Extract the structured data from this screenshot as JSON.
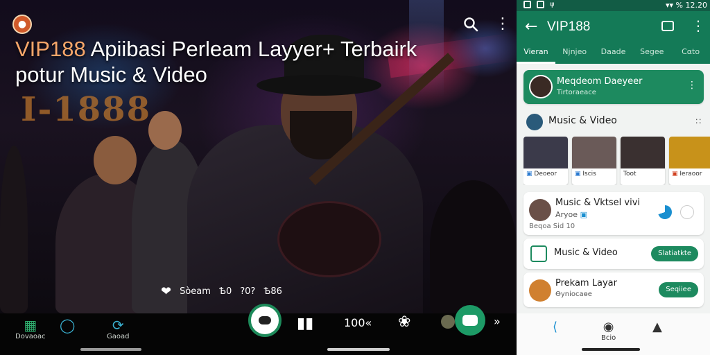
{
  "video": {
    "title_brand": "VIP188",
    "title_rest": " Apiibasi Perleam Layyer+ Terbairk potur Music & Video",
    "background_sign": "I-1888",
    "stats": [
      "Sòeam",
      "Ѣ0",
      "?0?",
      "Ѣ86"
    ],
    "bottom_items": [
      {
        "icon": "download-icon",
        "label": "Dovaoac"
      },
      {
        "icon": "chat-icon",
        "label": ""
      },
      {
        "icon": "refresh-icon",
        "label": "Gaoad"
      },
      {
        "icon": "equalizer-icon",
        "label": ""
      },
      {
        "icon": "speed-text",
        "label": "100«"
      },
      {
        "icon": "settings-icon",
        "label": ""
      },
      {
        "icon": "avatar-icon",
        "label": ""
      },
      {
        "icon": "collapse-icon",
        "label": "»"
      }
    ]
  },
  "phone": {
    "status": {
      "time": "12.20",
      "signal": "▾▾ %"
    },
    "app_title": "VIP188",
    "tabs": [
      "Vieran",
      "Njnjeo",
      "Daade",
      "Segee",
      "Cαto"
    ],
    "active_tab": 0,
    "hero": {
      "title": "Meqdeom Daeyeer",
      "subtitle": "Tirtoraeace"
    },
    "section_title": "Music & Video",
    "thumbs": [
      {
        "label": "Deoeor",
        "color": "#3b3a4a"
      },
      {
        "label": "Iscis",
        "color": "#6a5a58"
      },
      {
        "label": "Toot",
        "color": "#3a3030"
      },
      {
        "label": "Ieraoor",
        "color": "#c8921a"
      },
      {
        "label": "",
        "color": "#4a6a80"
      }
    ],
    "rows": [
      {
        "title": "Music & Vktsel vivi",
        "subtitle": "Aryoe",
        "meta": "Beqoa  Sid 10",
        "button": ""
      },
      {
        "title": "Music & Video",
        "subtitle": "",
        "meta": "",
        "button": "Slatiatkte"
      },
      {
        "title": "Prekam Layar",
        "subtitle": "Ѳyniocaѳe",
        "meta": "",
        "button": "Seqiiee"
      }
    ],
    "nav": [
      {
        "icon": "back-icon",
        "label": ""
      },
      {
        "icon": "profile-icon",
        "label": "Bcio"
      },
      {
        "icon": "thumb-icon",
        "label": ""
      }
    ]
  },
  "colors": {
    "accent": "#147a57",
    "accent_light": "#1d8a5f",
    "brand_orange": "#f6a66a"
  }
}
